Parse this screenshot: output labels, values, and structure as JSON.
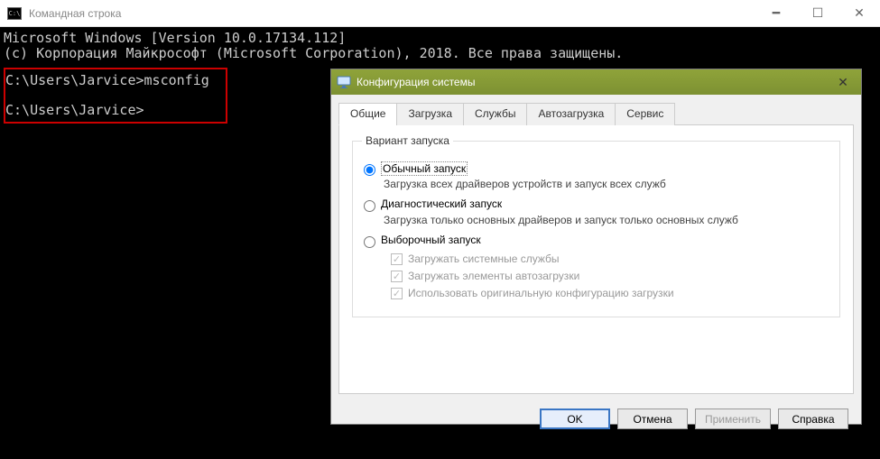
{
  "cmd": {
    "title": "Командная строка",
    "line1": "Microsoft Windows [Version 10.0.17134.112]",
    "line2": "(c) Корпорация Майкрософт (Microsoft Corporation), 2018. Все права защищены.",
    "prompt1": "C:\\Users\\Jarvice>",
    "command": "msconfig",
    "prompt2": "C:\\Users\\Jarvice>"
  },
  "dialog": {
    "title": "Конфигурация системы",
    "tabs": [
      "Общие",
      "Загрузка",
      "Службы",
      "Автозагрузка",
      "Сервис"
    ],
    "fieldset": "Вариант запуска",
    "opt1": {
      "label": "Обычный запуск",
      "desc": "Загрузка всех драйверов устройств и запуск всех служб"
    },
    "opt2": {
      "label": "Диагностический запуск",
      "desc": "Загрузка только основных драйверов и запуск только основных служб"
    },
    "opt3": {
      "label": "Выборочный запуск"
    },
    "chk1": "Загружать системные службы",
    "chk2": "Загружать элементы автозагрузки",
    "chk3": "Использовать оригинальную конфигурацию загрузки",
    "buttons": {
      "ok": "OK",
      "cancel": "Отмена",
      "apply": "Применить",
      "help": "Справка"
    }
  }
}
